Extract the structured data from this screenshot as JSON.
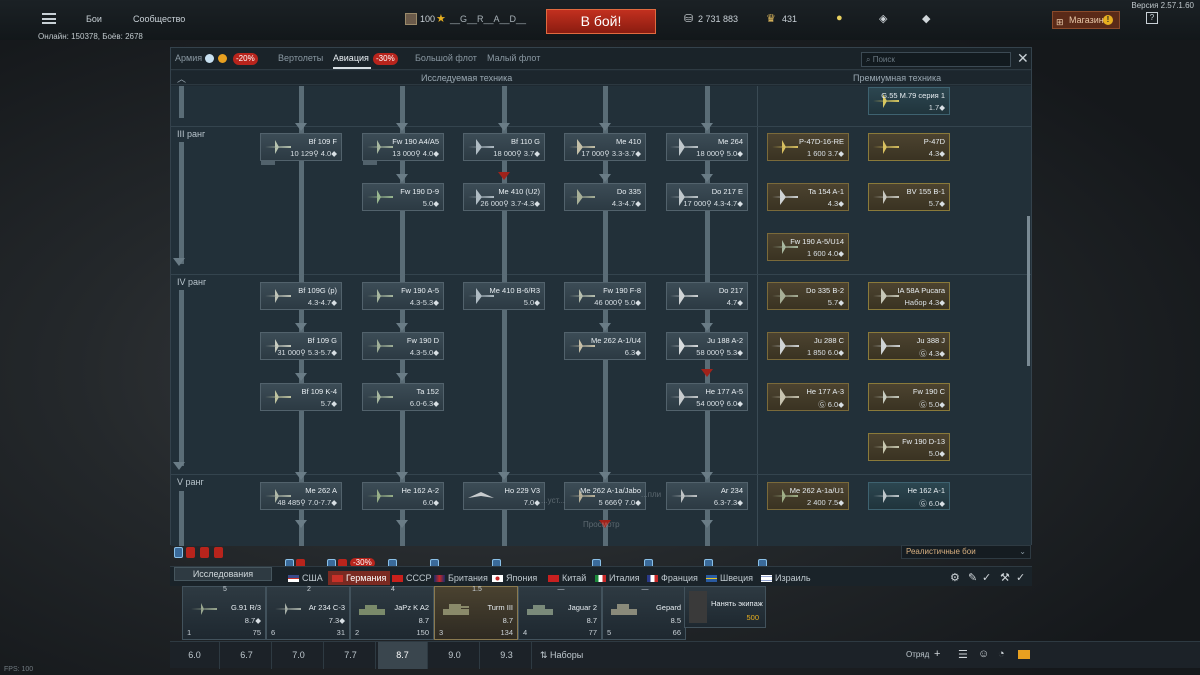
{
  "top": {
    "menu_items": [
      "Бои",
      "Сообщество"
    ],
    "level": "100",
    "nick": "__G__R__A__D__",
    "battle_button": "В бой!",
    "silver_lions": "2 731 883",
    "golden_eagles": "431",
    "shop": "Магазин",
    "help": "?",
    "version": "Версия 2.57.1.60",
    "online": "Онлайн: 150378, Боёв: 2678"
  },
  "tabs": {
    "army": "Армия",
    "army_discount": "-20%",
    "helicopters": "Вертолеты",
    "aviation": "Авиация",
    "aviation_discount": "-30%",
    "bluewater": "Большой флот",
    "coastal": "Малый флот",
    "search_placeholder": "Поиск"
  },
  "columns": {
    "researched": "Исследуемая техника",
    "premium": "Премиумная техника"
  },
  "ranks": [
    "III ранг",
    "IV ранг",
    "V ранг"
  ],
  "cards": [
    {
      "name": "Bf 109 F",
      "stats": "10 129⚲ 4.0◆"
    },
    {
      "name": "Fw 190 A4/A5",
      "stats": "13 000⚲ 4.0◆"
    },
    {
      "name": "Bf 110 G",
      "stats": "18 000⚲ 3.7◆"
    },
    {
      "name": "Me 410",
      "stats": "17 000⚲ 3.3-3.7◆"
    },
    {
      "name": "Me 264",
      "stats": "18 000⚲ 5.0◆"
    },
    {
      "name": "Fw 190 D-9",
      "stats": "5.0◆"
    },
    {
      "name": "Me 410 (U2)",
      "stats": "26 000⚲ 3.7-4.3◆"
    },
    {
      "name": "Do 335",
      "stats": "4.3-4.7◆"
    },
    {
      "name": "Do 217 E",
      "stats": "17 000⚲ 4.3-4.7◆"
    },
    {
      "name": "Bf 109G (p)",
      "stats": "4.3-4.7◆"
    },
    {
      "name": "Fw 190 A-5",
      "stats": "4.3-5.3◆"
    },
    {
      "name": "Me 410 B-6/R3",
      "stats": "5.0◆"
    },
    {
      "name": "Fw 190 F-8",
      "stats": "46 000⚲ 5.0◆"
    },
    {
      "name": "Do 217",
      "stats": "4.7◆"
    },
    {
      "name": "Bf 109 G",
      "stats": "31 000⚲ 5.3-5.7◆"
    },
    {
      "name": "Fw 190 D",
      "stats": "4.3-5.0◆"
    },
    {
      "name": "Me 262 A-1/U4",
      "stats": "6.3◆"
    },
    {
      "name": "Ju 188 A-2",
      "stats": "58 000⚲ 5.3◆"
    },
    {
      "name": "Bf 109 K-4",
      "stats": "5.7◆"
    },
    {
      "name": "Ta 152",
      "stats": "6.0-6.3◆"
    },
    {
      "name": "He 177 A-5",
      "stats": "54 000⚲ 6.0◆"
    },
    {
      "name": "Me 262 A",
      "stats": "48 485⚲ 7.0-7.7◆"
    },
    {
      "name": "He 162 A-2",
      "stats": "6.0◆"
    },
    {
      "name": "Ho 229 V3",
      "stats": "7.0◆"
    },
    {
      "name": "Me 262 A-1a/Jabo",
      "stats": "5 666⚲ 7.0◆"
    },
    {
      "name": "Ar 234",
      "stats": "6.3-7.3◆"
    }
  ],
  "premium_cards": [
    {
      "name": "G.55 M.79 серия 1",
      "stats": "1.7◆"
    },
    {
      "name": "P-47D-16-RE",
      "stats": "1 600 3.7◆"
    },
    {
      "name": "P-47D",
      "stats": "4.3◆"
    },
    {
      "name": "Ta 154 A-1",
      "stats": "4.3◆"
    },
    {
      "name": "BV 155 B-1",
      "stats": "5.7◆"
    },
    {
      "name": "Fw 190 A-5/U14",
      "stats": "1 600 4.0◆"
    },
    {
      "name": "Do 335 B-2",
      "stats": "5.7◆"
    },
    {
      "name": "IA 58A Pucara",
      "stats": "Набор 4.3◆"
    },
    {
      "name": "Ju 288 C",
      "stats": "1 850 6.0◆"
    },
    {
      "name": "Ju 388 J",
      "stats": "Ⓖ 4.3◆"
    },
    {
      "name": "He 177 A-3",
      "stats": "Ⓖ 6.0◆"
    },
    {
      "name": "Fw 190 C",
      "stats": "Ⓖ 5.0◆"
    },
    {
      "name": "Fw 190 D-13",
      "stats": "5.0◆"
    },
    {
      "name": "Me 262 A-1a/U1",
      "stats": "2 400 7.5◆"
    },
    {
      "name": "He 162 A-1",
      "stats": "Ⓖ 6.0◆"
    }
  ],
  "ghost_text": {
    "line1": "...уст...",
    "line2": "...пли",
    "line3": "Просмотр"
  },
  "bottom": {
    "mode": "Реалистичные бои",
    "research": "Исследования",
    "minus30": "-30%"
  },
  "nations": [
    {
      "name": "США"
    },
    {
      "name": "Германия"
    },
    {
      "name": "СССР"
    },
    {
      "name": "Британия"
    },
    {
      "name": "Япония"
    },
    {
      "name": "Китай"
    },
    {
      "name": "Италия"
    },
    {
      "name": "Франция"
    },
    {
      "name": "Швеция"
    },
    {
      "name": "Израиль"
    }
  ],
  "crew": [
    {
      "top": "5",
      "name": "G.91 R/3",
      "rating": "8.7◆",
      "left": "1",
      "right": "75"
    },
    {
      "top": "2",
      "name": "Ar 234 C-3",
      "rating": "7.3◆",
      "left": "6",
      "right": "31"
    },
    {
      "top": "4",
      "name": "JaPz K A2",
      "rating": "8.7",
      "left": "2",
      "right": "150"
    },
    {
      "top": "1.5",
      "name": "Turm III",
      "rating": "8.7",
      "left": "3",
      "right": "134"
    },
    {
      "top": "—",
      "name": "Jaguar 2",
      "rating": "8.7",
      "left": "4",
      "right": "77"
    },
    {
      "top": "—",
      "name": "Gepard",
      "rating": "8.5",
      "left": "5",
      "right": "66"
    }
  ],
  "hire": {
    "label": "Нанять экипаж",
    "cost": "500"
  },
  "br_tabs": [
    "6.0",
    "6.7",
    "7.0",
    "7.7",
    "8.7",
    "9.0",
    "9.3"
  ],
  "sets": "Наборы",
  "squad": "Отряд",
  "fps": "FPS: 100",
  "colors": {
    "accent_red": "#b8241c",
    "battle_red": "#c2301f",
    "gold": "#e8b020"
  }
}
